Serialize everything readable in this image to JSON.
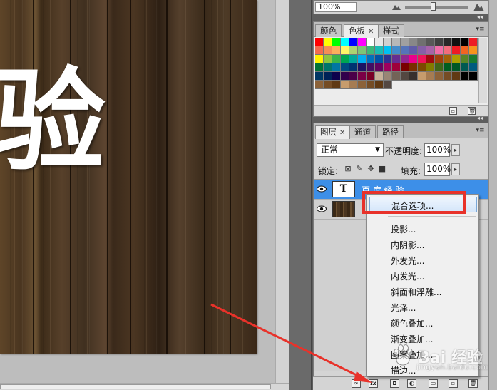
{
  "canvas": {
    "glyph": "验"
  },
  "navigator": {
    "zoom": "100%"
  },
  "swatches_panel": {
    "tabs": [
      {
        "label": "颜色",
        "active": false
      },
      {
        "label": "色板",
        "active": true
      },
      {
        "label": "样式",
        "active": false
      }
    ],
    "rows": [
      [
        "#ff0000",
        "#ffff00",
        "#00ff00",
        "#00ffff",
        "#0000ff",
        "#ff00ff",
        "#ffffff",
        "#e8e8e8",
        "#d0d0d0",
        "#b8b8b8",
        "#a0a0a0",
        "#888888",
        "#707070",
        "#585858",
        "#404040",
        "#282828",
        "#101010",
        "#000000",
        "#ee1c24"
      ],
      [
        "#f26c4f",
        "#f68e55",
        "#fbaf5c",
        "#fff467",
        "#acd372",
        "#7cc576",
        "#3bb878",
        "#1abbb4",
        "#00bff3",
        "#438ccb",
        "#5574b9",
        "#605ca8",
        "#855fa8",
        "#a763a8",
        "#f06ea9",
        "#f26d7d",
        "#ed1c24",
        "#f26522",
        "#f7941d"
      ],
      [
        "#fff200",
        "#8dc63f",
        "#39b54a",
        "#00a651",
        "#00a99d",
        "#00aeef",
        "#0072bc",
        "#0054a6",
        "#2e3192",
        "#662d91",
        "#92278f",
        "#ec008c",
        "#ed145b",
        "#9e0b0f",
        "#a0410d",
        "#a36209",
        "#aba000",
        "#598527",
        "#1a7b30"
      ],
      [
        "#007236",
        "#00746b",
        "#0076a3",
        "#004b80",
        "#003471",
        "#1b1464",
        "#440e62",
        "#630460",
        "#9e005d",
        "#9e0039",
        "#790000",
        "#7b2e00",
        "#7d4900",
        "#827b00",
        "#406618",
        "#005e20",
        "#005826",
        "#005952",
        "#005b7f"
      ],
      [
        "#003663",
        "#002157",
        "#0d004c",
        "#32004b",
        "#4b0049",
        "#7b0046",
        "#7a0026",
        "#c7b299",
        "#998675",
        "#736357",
        "#534741",
        "#37302d",
        "#c69c6d",
        "#a67c52",
        "#8c6239",
        "#754c24",
        "#603913",
        "#000000",
        "#000000"
      ],
      [
        "#8c6239",
        "#754c24",
        "#603913",
        "#c69c6d",
        "#a67c52",
        "#8c6239",
        "#754c24",
        "#603913",
        "#534741"
      ]
    ]
  },
  "layers_panel": {
    "tabs": [
      {
        "label": "图层",
        "active": true
      },
      {
        "label": "通道",
        "active": false
      },
      {
        "label": "路径",
        "active": false
      }
    ],
    "blend_mode": "正常",
    "opacity_label": "不透明度:",
    "opacity_value": "100%",
    "lock_label": "锁定:",
    "fill_label": "填充:",
    "fill_value": "100%",
    "layers": [
      {
        "name": "百 度 经 验",
        "type": "text",
        "thumb_label": "T",
        "selected": true
      },
      {
        "name": "",
        "type": "image",
        "thumb_label": "",
        "selected": false
      }
    ]
  },
  "context_menu": {
    "highlighted": "混合选项...",
    "items": [
      "投影...",
      "内阴影...",
      "外发光...",
      "内发光...",
      "斜面和浮雕...",
      "光泽...",
      "颜色叠加...",
      "渐变叠加...",
      "图案叠加...",
      "描边..."
    ]
  },
  "watermark": {
    "text": "Bai 经验",
    "sub": "jingyan.baidu.com"
  },
  "colors": {
    "annotation_red": "#e8322a",
    "selection_blue": "#3d8fe8"
  }
}
